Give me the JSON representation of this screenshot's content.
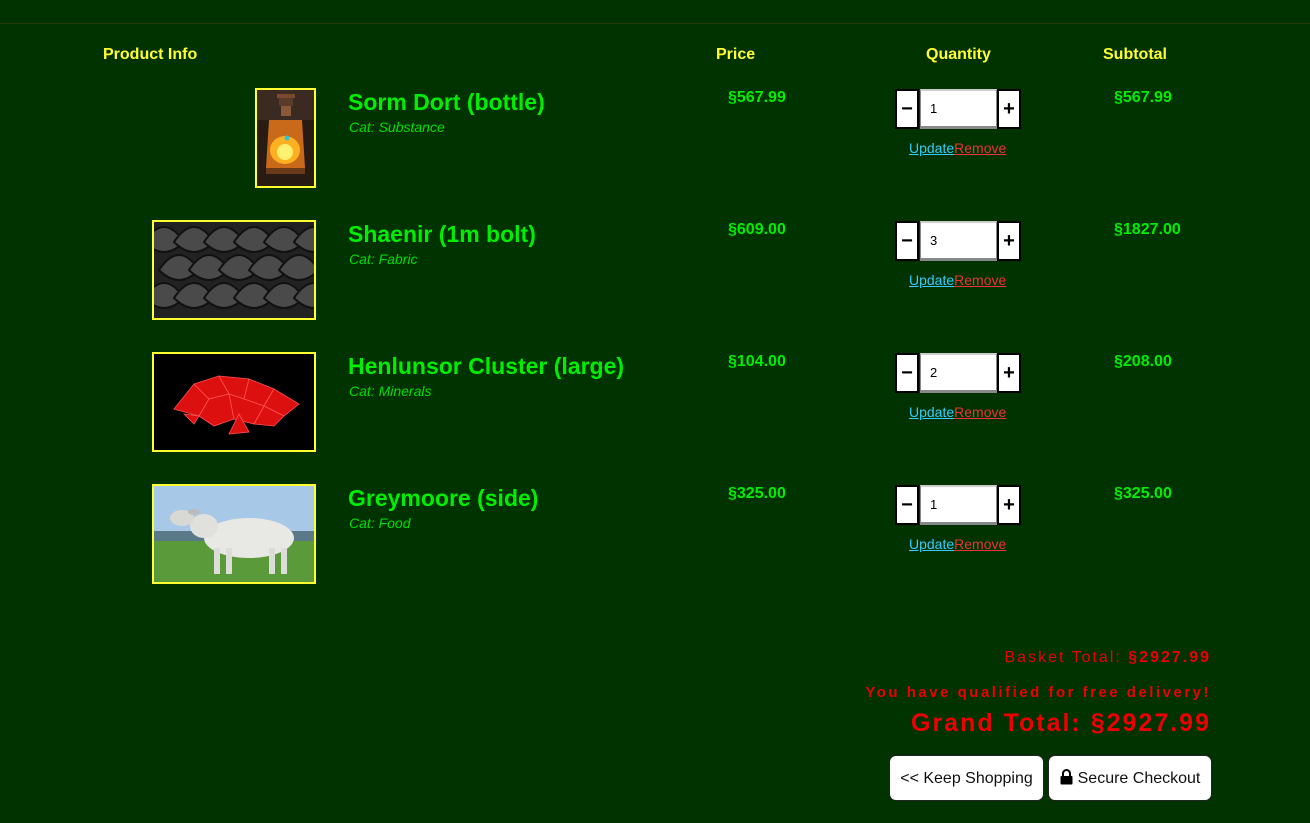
{
  "currency_symbol": "§",
  "headers": {
    "product_info": "Product Info",
    "price": "Price",
    "quantity": "Quantity",
    "subtotal": "Subtotal"
  },
  "items": [
    {
      "name": "Sorm Dort (bottle)",
      "category": "Cat: Substance",
      "price": "§567.99",
      "quantity": "1",
      "subtotal": "§567.99",
      "image_icon": "potion-bottle-image"
    },
    {
      "name": "Shaenir (1m bolt)",
      "category": "Cat: Fabric",
      "price": "§609.00",
      "quantity": "3",
      "subtotal": "§1827.00",
      "image_icon": "scale-fabric-image"
    },
    {
      "name": "Henlunsor Cluster (large)",
      "category": "Cat: Minerals",
      "price": "§104.00",
      "quantity": "2",
      "subtotal": "§208.00",
      "image_icon": "red-crystal-cluster-image"
    },
    {
      "name": "Greymoore (side)",
      "category": "Cat: Food",
      "price": "§325.00",
      "quantity": "1",
      "subtotal": "§325.00",
      "image_icon": "white-cattle-image"
    }
  ],
  "controls": {
    "minus_label": "−",
    "plus_label": "+",
    "update_label": "Update",
    "remove_label": "Remove"
  },
  "totals": {
    "basket_label": "Basket Total:",
    "basket_value": "§2927.99",
    "free_delivery_message": "You have qualified for free delivery!",
    "grand_label": "Grand Total:",
    "grand_value": "§2927.99"
  },
  "buttons": {
    "keep_shopping": "<< Keep Shopping",
    "secure_checkout": "Secure Checkout"
  },
  "colors": {
    "background": "#003300",
    "header_text": "#ffff33",
    "product_text": "#00ee00",
    "update_link": "#33ccff",
    "remove_link": "#ee3333",
    "totals_text": "#ee0000"
  }
}
